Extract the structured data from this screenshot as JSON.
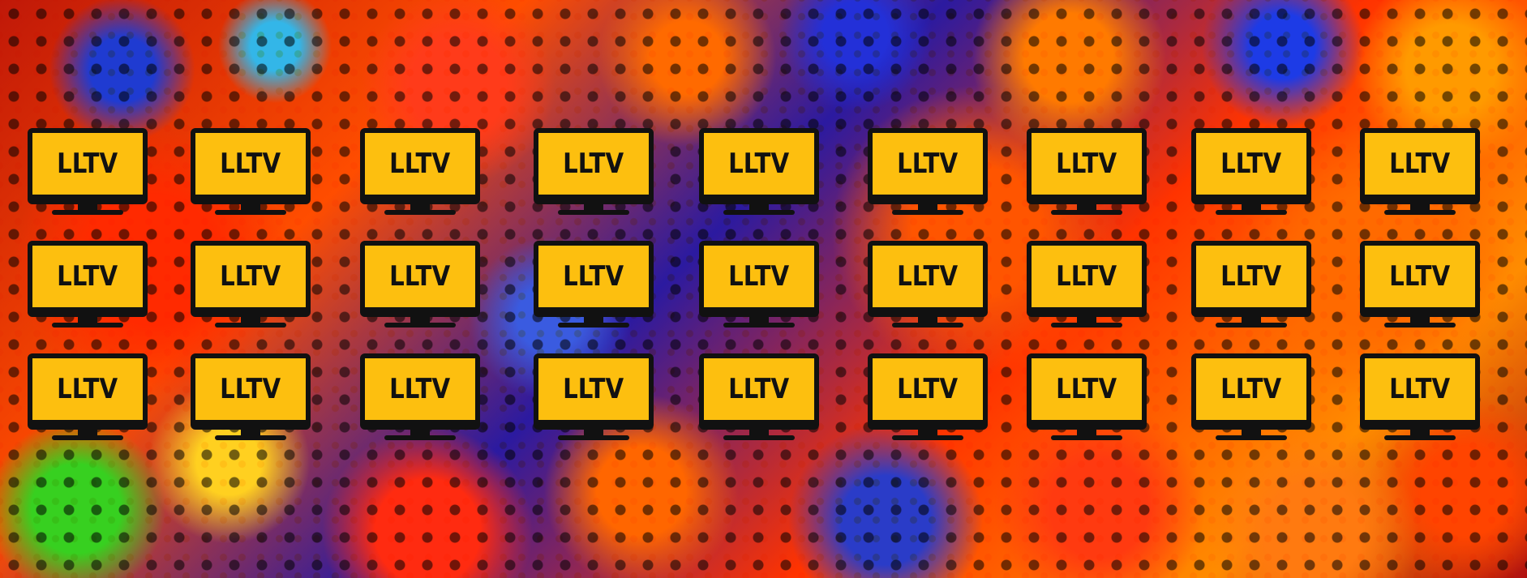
{
  "banner": {
    "tv_label": "LLTV",
    "rows": 3,
    "columns": 9,
    "icon_name": "tv-monitor-icon",
    "colors": {
      "screen": "#fdbf0f",
      "frame": "#111111"
    }
  }
}
